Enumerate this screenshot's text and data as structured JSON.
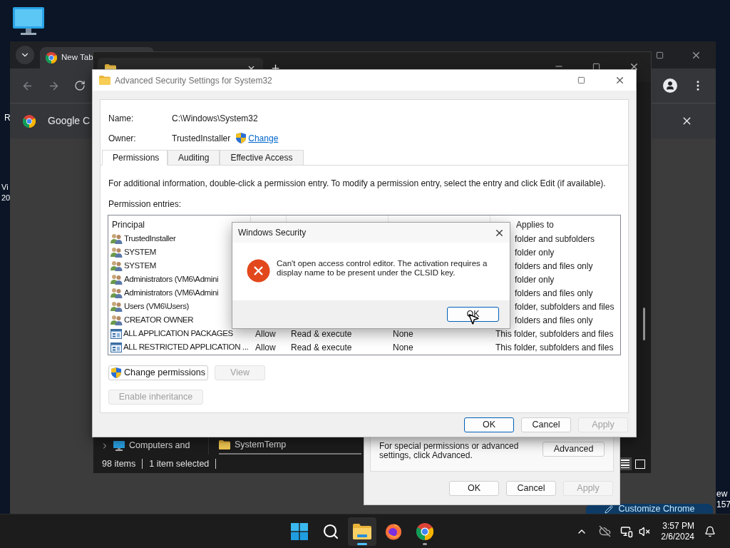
{
  "desktop": {
    "left_texts": [
      "R",
      "Vi",
      "20"
    ],
    "right_texts": [
      "ew",
      "157"
    ]
  },
  "chrome": {
    "tab": "New Tab",
    "infobar": "Google C",
    "customize_button": "Customize Chrome"
  },
  "explorer": {
    "nav_item": "Computers and",
    "folder": "SystemTemp",
    "status": [
      "98 items",
      "1 item selected"
    ]
  },
  "properties": {
    "note": "For special permissions or advanced settings, click Advanced.",
    "advanced_button": "Advanced",
    "buttons": [
      {
        "label": "OK",
        "disabled": false,
        "default": false
      },
      {
        "label": "Cancel",
        "disabled": false,
        "default": false
      },
      {
        "label": "Apply",
        "disabled": true,
        "default": false
      }
    ]
  },
  "advanced": {
    "title": "Advanced Security Settings for System32",
    "name_label": "Name:",
    "name_value": "C:\\Windows\\System32",
    "owner_label": "Owner:",
    "owner_value": "TrustedInstaller",
    "change_link": "Change",
    "tabs": [
      {
        "label": "Permissions",
        "selected": true
      },
      {
        "label": "Auditing",
        "selected": false
      },
      {
        "label": "Effective Access",
        "selected": false
      }
    ],
    "info": "For additional information, double-click a permission entry. To modify a permission entry, select the entry and click Edit (if available).",
    "entries_label": "Permission entries:",
    "columns": [
      "Principal",
      "Applies to"
    ],
    "rows": [
      {
        "kind": "user",
        "principal": "TrustedInstaller",
        "applies": "folder and subfolders"
      },
      {
        "kind": "user",
        "principal": "SYSTEM",
        "applies": "folder only"
      },
      {
        "kind": "user",
        "principal": "SYSTEM",
        "applies": "folders and files only"
      },
      {
        "kind": "user",
        "principal": "Administrators (VM6\\Admini",
        "applies": "folder only"
      },
      {
        "kind": "user",
        "principal": "Administrators (VM6\\Admini",
        "applies": "folders and files only"
      },
      {
        "kind": "user",
        "principal": "Users (VM6\\Users)",
        "applies": "folder, subfolders and files"
      },
      {
        "kind": "user",
        "principal": "CREATOR OWNER",
        "applies": "folders and files only"
      },
      {
        "kind": "package",
        "principal": "ALL APPLICATION PACKAGES",
        "type": "Allow",
        "access": "Read & execute",
        "inherited": "None",
        "applies": "This folder, subfolders and files"
      },
      {
        "kind": "package",
        "principal": "ALL RESTRICTED APPLICATION ...",
        "type": "Allow",
        "access": "Read & execute",
        "inherited": "None",
        "applies": "This folder, subfolders and files"
      }
    ],
    "buttons": [
      {
        "label": "Change permissions",
        "disabled": false,
        "shield": true
      },
      {
        "label": "View",
        "disabled": true,
        "shield": false
      }
    ],
    "inheritance_button": {
      "label": "Enable inheritance",
      "disabled": true
    },
    "footer_buttons": [
      {
        "label": "OK",
        "disabled": false,
        "default": true
      },
      {
        "label": "Cancel",
        "disabled": false,
        "default": false
      },
      {
        "label": "Apply",
        "disabled": true,
        "default": false
      }
    ]
  },
  "message_box": {
    "title": "Windows Security",
    "message": "Can't open access control editor. The activation requires a display name to be present under the CLSID key.",
    "button": {
      "label": "OK",
      "default": true
    }
  },
  "taskbar": {
    "apps": [
      {
        "kind": "start",
        "active": false,
        "running": false
      },
      {
        "kind": "search",
        "active": false,
        "running": false
      },
      {
        "kind": "explorer",
        "active": true,
        "running": true
      },
      {
        "kind": "firefox",
        "active": false,
        "running": false
      },
      {
        "kind": "chrome",
        "active": false,
        "running": true
      }
    ],
    "time": "3:57 PM",
    "date": "2/6/2024"
  }
}
